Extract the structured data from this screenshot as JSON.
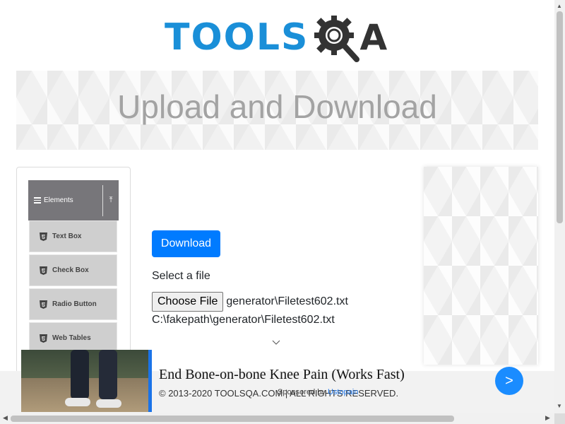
{
  "logo": {
    "text_tools": "TOOLS",
    "text_a": "A",
    "brand_color": "#1a8fd8",
    "dark_color": "#333333"
  },
  "banner": {
    "title": "Upload and Download"
  },
  "sidebar": {
    "group_label": "Elements",
    "group_icon": "hamburger-icon",
    "collapse_icon": "collapse-up-icon",
    "items": [
      {
        "label": "Text Box",
        "icon": "html5-icon"
      },
      {
        "label": "Check Box",
        "icon": "html5-icon"
      },
      {
        "label": "Radio Button",
        "icon": "html5-icon"
      },
      {
        "label": "Web Tables",
        "icon": "html5-icon"
      }
    ]
  },
  "main": {
    "download_label": "Download",
    "select_label": "Select a file",
    "choose_file_label": "Choose File",
    "chosen_file_name": "generator\\Filetest602.txt",
    "uploaded_path": "C:\\fakepath\\generator\\Filetest602.txt",
    "accent_color": "#007bff"
  },
  "footer": {
    "copyright": "© 2013-2020 TOOLSQA.COM | ALL RIGHTS RESERVED."
  },
  "ad": {
    "title": "End Bone-on-bone Knee Pain (Works Fast)",
    "sponsor_prefix": "Sponsored by",
    "sponsor_brand": "Ustopain",
    "arrow_label": ">",
    "arrow_color": "#1a8cff"
  },
  "scrollbars": {
    "up_arrow": "▲",
    "down_arrow": "▼",
    "left_arrow": "◀",
    "right_arrow": "▶"
  }
}
